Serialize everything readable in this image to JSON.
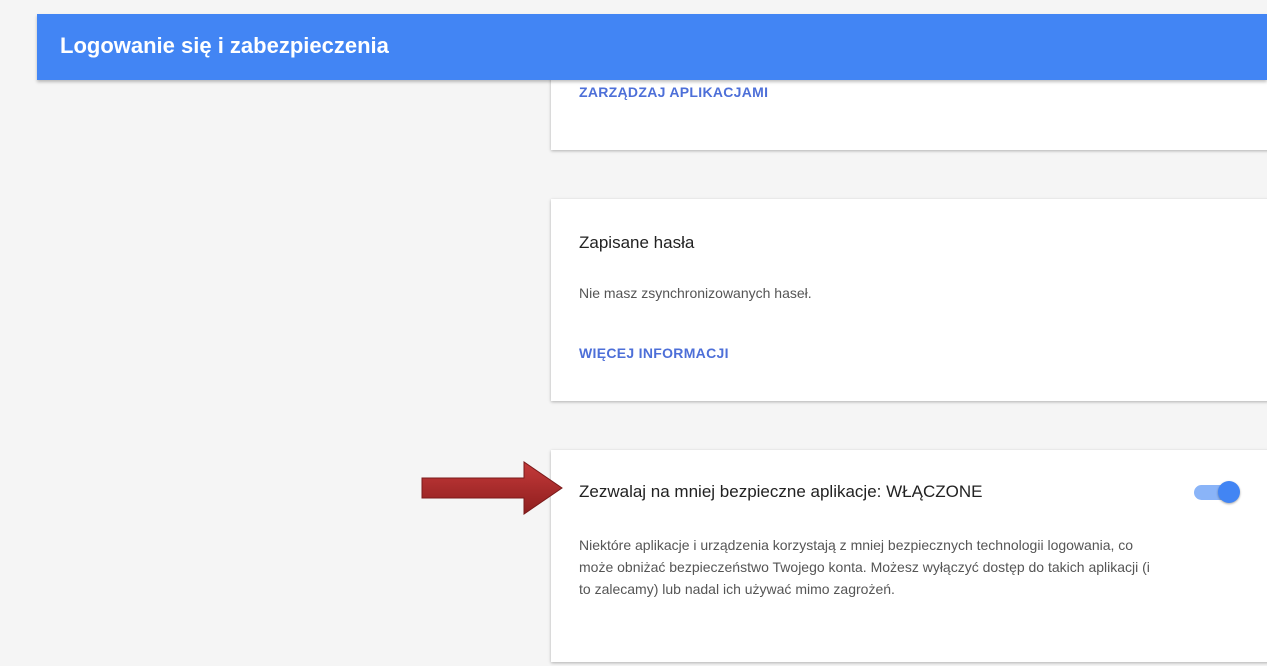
{
  "header": {
    "title": "Logowanie się i zabezpieczenia"
  },
  "apps_card": {
    "manage_link": "ZARZĄDZAJ APLIKACJAMI"
  },
  "passwords_card": {
    "title": "Zapisane hasła",
    "description": "Nie masz zsynchronizowanych haseł.",
    "more_info_link": "WIĘCEJ INFORMACJI"
  },
  "less_secure_card": {
    "title": "Zezwalaj na mniej bezpieczne aplikacje: WŁĄCZONE",
    "description": "Niektóre aplikacje i urządzenia korzystają z mniej bezpiecznych technologii logowania, co może obniżać bezpieczeństwo Twojego konta. Możesz wyłączyć dostęp do takich aplikacji (i to zalecamy) lub nadal ich używać mimo zagrożeń.",
    "toggle_on": true
  },
  "colors": {
    "header_bg": "#4285f4",
    "link": "#4d6fd8",
    "toggle_track": "#8ab4f8",
    "toggle_knob": "#4285f4",
    "annotation_arrow": "#b02a2a"
  },
  "icons": {
    "annotation": "red-arrow-icon"
  }
}
